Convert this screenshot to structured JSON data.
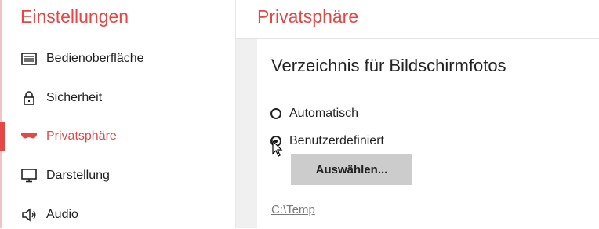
{
  "sidebar": {
    "title": "Einstellungen",
    "items": [
      {
        "label": "Bedienoberfläche",
        "icon": "keyboard-icon"
      },
      {
        "label": "Sicherheit",
        "icon": "lock-icon"
      },
      {
        "label": "Privatsphäre",
        "icon": "mask-icon",
        "active": true
      },
      {
        "label": "Darstellung",
        "icon": "monitor-icon"
      },
      {
        "label": "Audio",
        "icon": "speaker-icon"
      }
    ]
  },
  "header": {
    "title": "Privatsphäre"
  },
  "screenshot_section": {
    "title": "Verzeichnis für Bildschirmfotos",
    "options": [
      {
        "label": "Automatisch",
        "checked": false
      },
      {
        "label": "Benutzerdefiniert",
        "checked": true
      }
    ],
    "select_button": "Auswählen...",
    "path": "C:\\Temp"
  },
  "colors": {
    "accent": "#e84545"
  }
}
